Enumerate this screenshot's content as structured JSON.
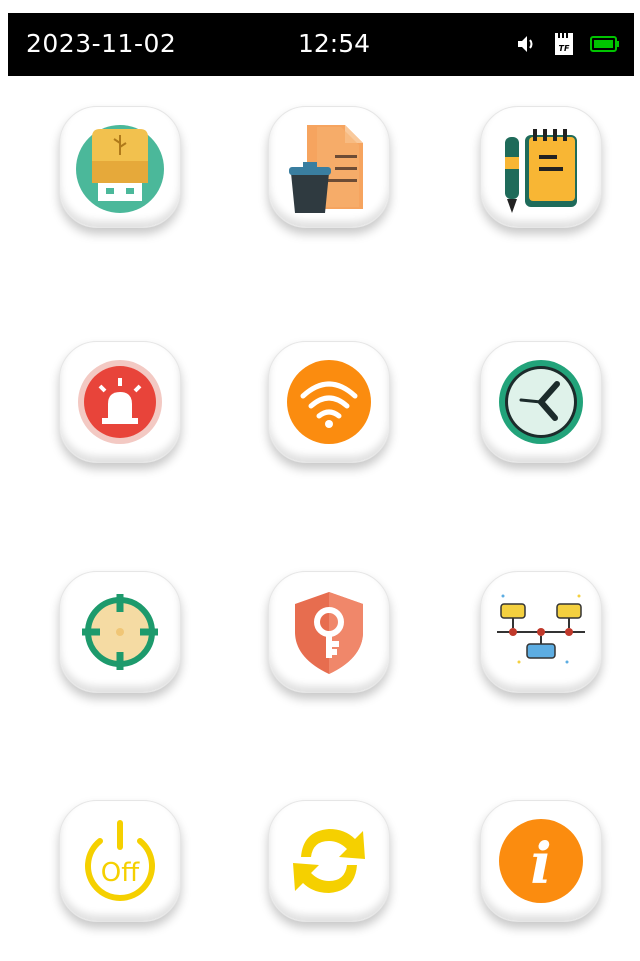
{
  "status_bar": {
    "date": "2023-11-02",
    "time": "12:54",
    "icons": [
      "speaker-icon",
      "tf-card-icon",
      "battery-icon"
    ],
    "tf_label": "TF",
    "battery_color": "#00c400"
  },
  "apps": [
    {
      "icon": "usb-drive-icon"
    },
    {
      "icon": "delete-files-icon"
    },
    {
      "icon": "notepad-icon"
    },
    {
      "icon": "alarm-icon"
    },
    {
      "icon": "wifi-icon"
    },
    {
      "icon": "clock-icon"
    },
    {
      "icon": "target-icon"
    },
    {
      "icon": "password-key-icon"
    },
    {
      "icon": "network-timeline-icon"
    },
    {
      "icon": "power-off-icon",
      "label": "Off"
    },
    {
      "icon": "refresh-icon"
    },
    {
      "icon": "info-icon",
      "label": "i"
    }
  ]
}
